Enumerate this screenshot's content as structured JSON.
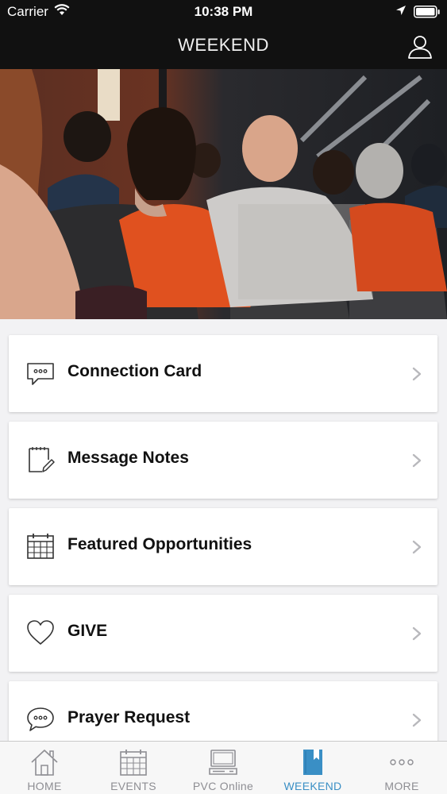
{
  "status_bar": {
    "carrier": "Carrier",
    "time": "10:38 PM"
  },
  "nav": {
    "title": "WEEKEND",
    "profile_icon": "person-outline-icon"
  },
  "hero": {
    "image": "audience-in-auditorium-photo"
  },
  "menu": [
    {
      "label": "Connection Card",
      "icon": "chat-bubble-dots-icon"
    },
    {
      "label": "Message Notes",
      "icon": "notepad-pencil-icon"
    },
    {
      "label": "Featured Opportunities",
      "icon": "calendar-icon"
    },
    {
      "label": "GIVE",
      "icon": "heart-icon"
    },
    {
      "label": "Prayer Request",
      "icon": "speech-bubble-dots-icon"
    }
  ],
  "tabs": [
    {
      "label": "HOME",
      "icon": "house-icon",
      "active": false
    },
    {
      "label": "EVENTS",
      "icon": "calendar-icon",
      "active": false
    },
    {
      "label": "PVC Online",
      "icon": "computer-icon",
      "active": false
    },
    {
      "label": "WEEKEND",
      "icon": "bookmark-book-icon",
      "active": true
    },
    {
      "label": "MORE",
      "icon": "ellipsis-icon",
      "active": false
    }
  ],
  "colors": {
    "active_tab": "#3a8fc5",
    "inactive_tab": "#8e8e93",
    "header_bg": "#111111"
  }
}
